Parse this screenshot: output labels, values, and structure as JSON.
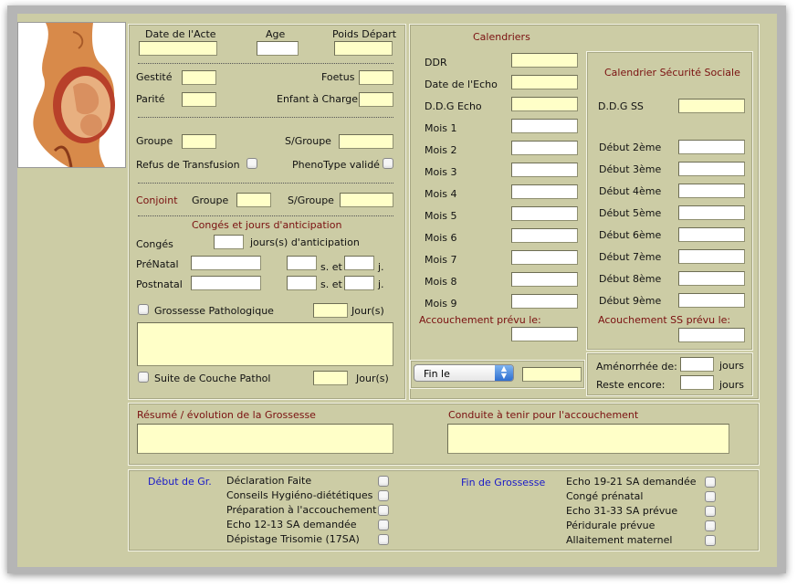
{
  "patient": {
    "date_acte_label": "Date de l'Acte",
    "age_label": "Age",
    "poids_label": "Poids Départ",
    "gestite_label": "Gestité",
    "parite_label": "Parité",
    "foetus_label": "Foetus",
    "enfant_label": "Enfant à Charge",
    "groupe_label": "Groupe",
    "sgroupe_label": "S/Groupe",
    "refus_label": "Refus de Transfusion",
    "pheno_label": "PhenoType validé",
    "conjoint_label": "Conjoint",
    "conjoint_groupe_label": "Groupe",
    "conjoint_sgroupe_label": "S/Groupe",
    "conges_title": "Congés et jours d'anticipation",
    "conges_label": "Congés",
    "jours_anticipation_label": "jours(s) d'anticipation",
    "prenatal_label": "PréNatal",
    "postnatal_label": "Postnatal",
    "s_et_label": "s. et",
    "j_label": "j.",
    "grossesse_patho_label": "Grossesse Pathologique",
    "jours_label": "Jour(s)",
    "suite_couche_label": "Suite de Couche Pathol"
  },
  "calendriers": {
    "title": "Calendriers",
    "rows": [
      "DDR",
      "Date de l'Echo",
      "D.D.G Echo",
      "Mois 1",
      "Mois 2",
      "Mois 3",
      "Mois 4",
      "Mois 5",
      "Mois 6",
      "Mois 7",
      "Mois 8",
      "Mois 9"
    ],
    "accouchement_label": "Accouchement prévu le:",
    "fin_select": "Fin le"
  },
  "secu": {
    "title": "Calendrier Sécurité Sociale",
    "ddg_label": "D.D.G SS",
    "rows": [
      "Début 2ème",
      "Début 3ème",
      "Début 4ème",
      "Début 5ème",
      "Début 6ème",
      "Début 7ème",
      "Début 8ème",
      "Début 9ème"
    ],
    "accouchement_label": "Acouchement SS prévu le:",
    "amenorrhee_label": "Aménorrhée de:",
    "reste_label": "Reste encore:",
    "jours_label": "jours"
  },
  "resume": {
    "resume_label": "Résumé / évolution de la Grossesse",
    "conduite_label": "Conduite à tenir pour l'accouchement"
  },
  "checklist": {
    "debut_label": "Début de Gr.",
    "debut_items": [
      "Déclaration Faite",
      "Conseils Hygiéno-diététiques",
      "Préparation à l'accouchement",
      "Echo 12-13 SA demandée",
      "Dépistage Trisomie (17SA)"
    ],
    "fin_label": "Fin de Grossesse",
    "fin_items": [
      "Echo 19-21 SA demandée",
      "Congé prénatal",
      "Echo 31-33 SA prévue",
      "Péridurale prévue",
      "Allaitement maternel"
    ]
  },
  "colors": {
    "background": "#cccca5",
    "field": "#ffffc8",
    "accent_red": "#7a1010",
    "accent_blue": "#1818c8"
  }
}
